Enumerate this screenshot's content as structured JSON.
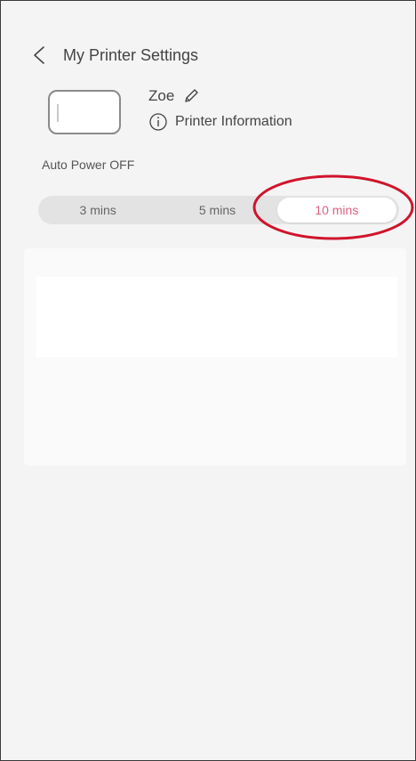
{
  "header": {
    "title": "My Printer Settings",
    "back_icon": "chevron-left-icon"
  },
  "printer": {
    "name": "Zoe",
    "edit_icon": "pencil-icon",
    "info_label": "Printer Information",
    "info_icon": "info-circle-icon"
  },
  "auto_power_off": {
    "label": "Auto Power OFF",
    "options": [
      "3 mins",
      "5 mins",
      "10 mins"
    ],
    "selected": "10 mins"
  },
  "colors": {
    "accent": "#e0607f",
    "highlight": "#d0142c",
    "background": "#f4f4f4"
  }
}
